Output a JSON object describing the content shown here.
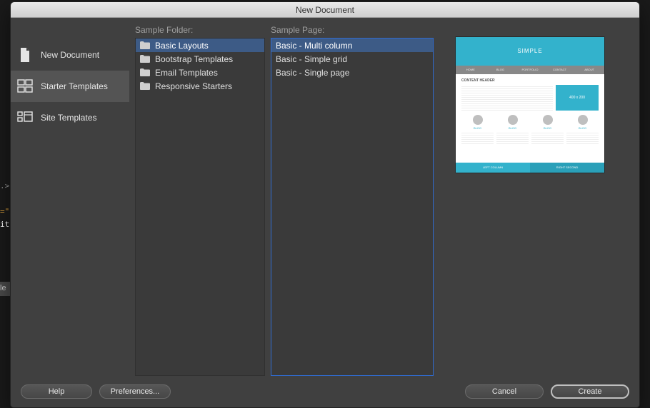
{
  "window": {
    "title": "New Document"
  },
  "sidebar": {
    "items": [
      {
        "label": "New Document"
      },
      {
        "label": "Starter Templates"
      },
      {
        "label": "Site Templates"
      }
    ],
    "selected_index": 1
  },
  "folder": {
    "label": "Sample Folder:",
    "items": [
      {
        "label": "Basic Layouts"
      },
      {
        "label": "Bootstrap Templates"
      },
      {
        "label": "Email Templates"
      },
      {
        "label": "Responsive Starters"
      }
    ],
    "selected_index": 0
  },
  "page": {
    "label": "Sample Page:",
    "items": [
      {
        "label": "Basic - Multi column"
      },
      {
        "label": "Basic - Simple grid"
      },
      {
        "label": "Basic - Single page"
      }
    ],
    "selected_index": 0
  },
  "preview": {
    "hero": "SIMPLE",
    "nav": [
      "HOME",
      "BLOG",
      "PORTFOLIO",
      "CONTACT",
      "ABOUT"
    ],
    "heading": "CONTENT HEADER",
    "img_label": "400 x 200",
    "col_head": "BLOG",
    "foot_left": "LEFT COLUMN",
    "foot_right": "RIGHT SECOND"
  },
  "buttons": {
    "help": "Help",
    "prefs": "Preferences...",
    "cancel": "Cancel",
    "create": "Create"
  },
  "background": {
    "l1": ".>",
    "l2": "=\"",
    "l3": "it",
    "l4": "le"
  }
}
